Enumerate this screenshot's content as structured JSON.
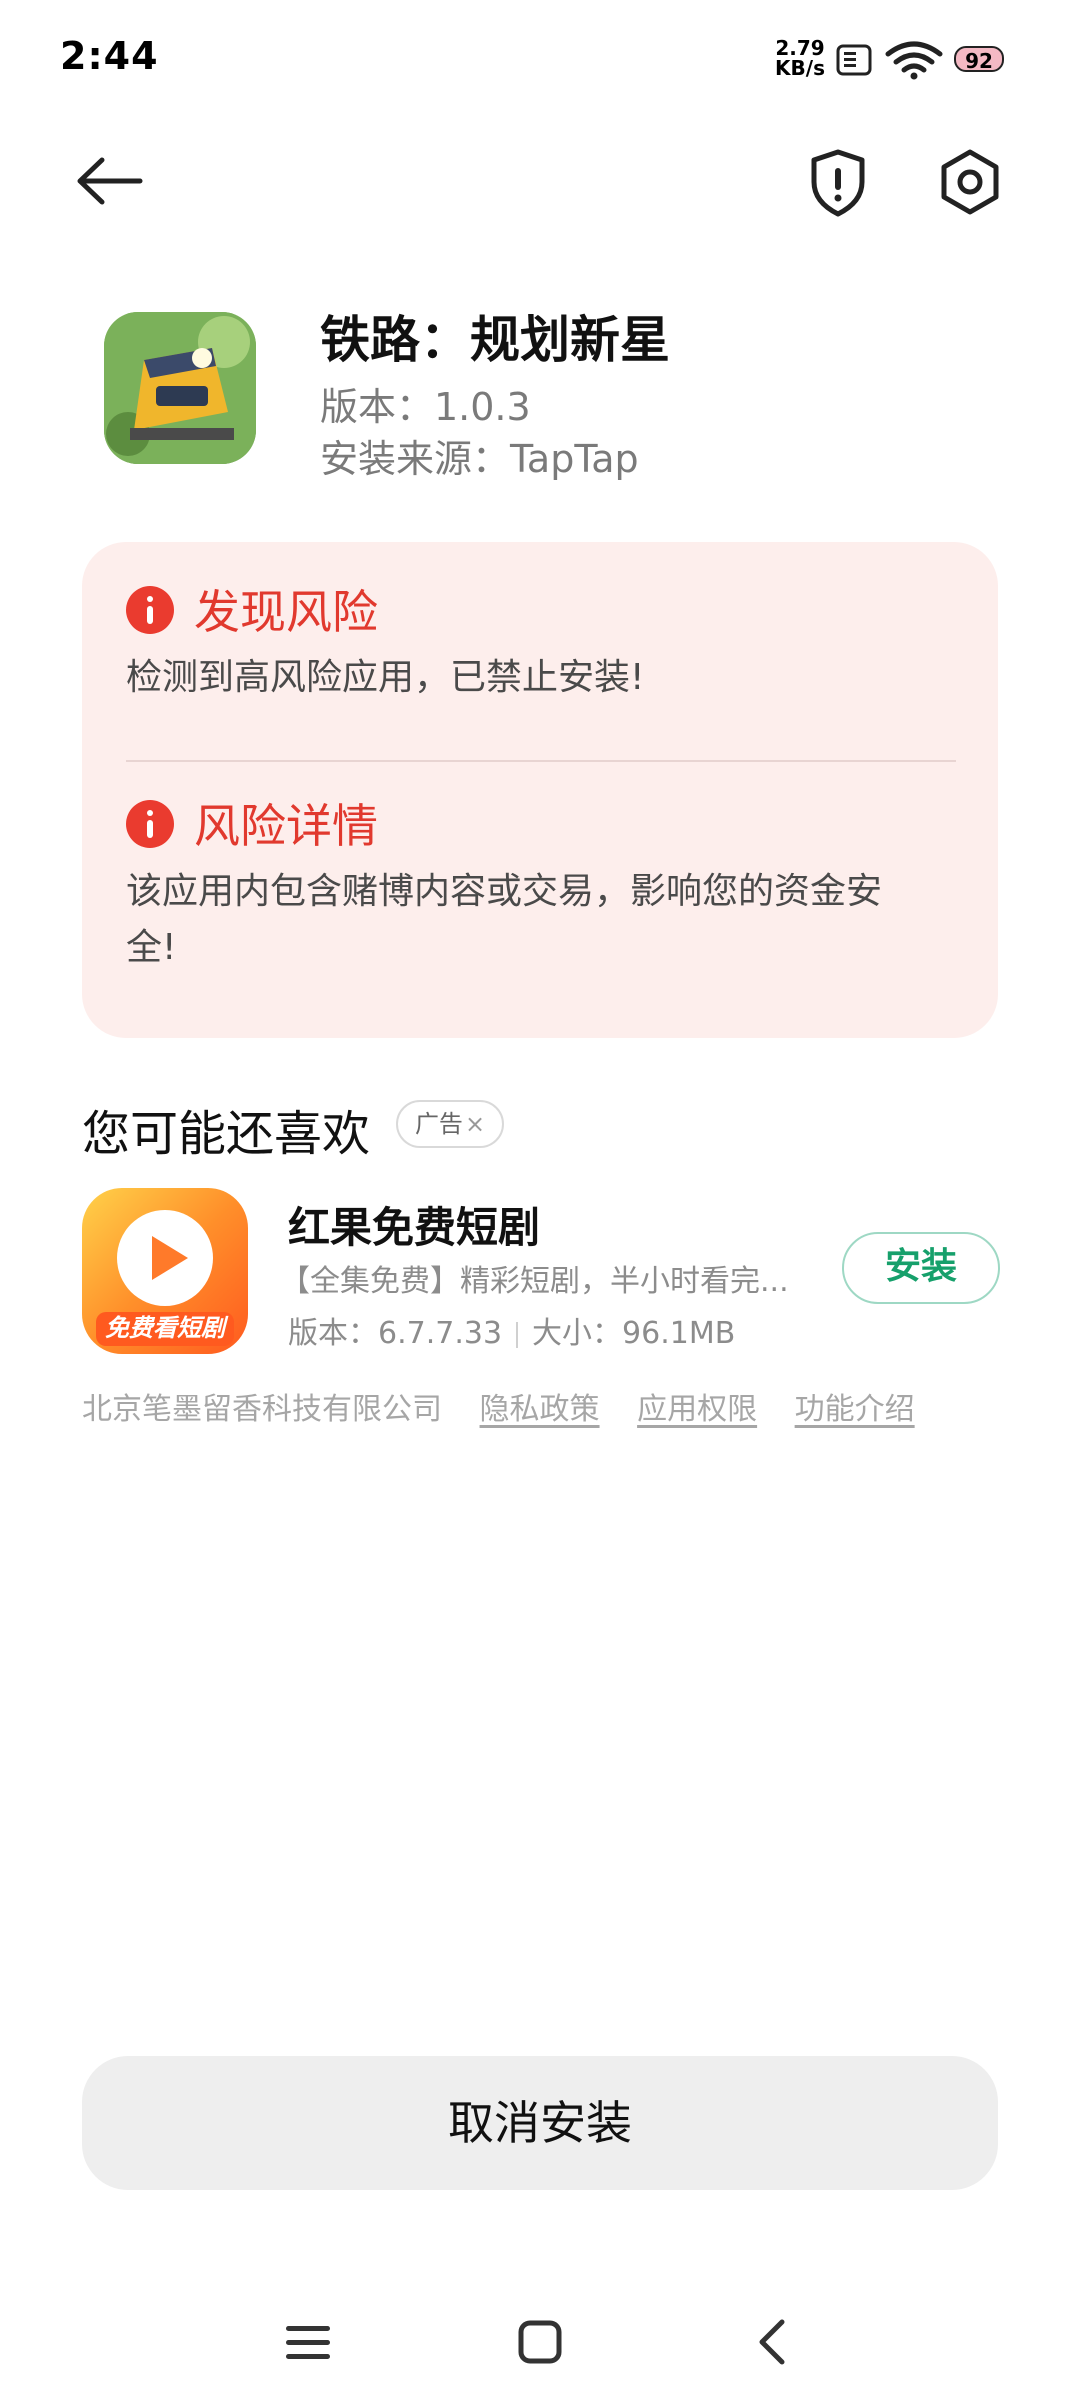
{
  "status_bar": {
    "time": "2:44",
    "net_speed_value": "2.79",
    "net_speed_unit": "KB/s",
    "battery_level": "92"
  },
  "app": {
    "name": "铁路：规划新星",
    "version": "版本：1.0.3",
    "source": "安装来源：TapTap"
  },
  "risk": {
    "title": "发现风险",
    "message": "检测到高风险应用，已禁止安装!",
    "detail_title": "风险详情",
    "detail_line1": "该应用内包含赌博内容或交易，影响您的资金安",
    "detail_line2": "全!",
    "accent_color": "#e1392e"
  },
  "recommendation": {
    "section_title": "您可能还喜欢",
    "ad_label": "广告",
    "ad_close": "×",
    "app": {
      "name": "红果免费短剧",
      "description": "【全集免费】精彩短剧，半小时看完...",
      "version": "版本：6.7.7.33",
      "size": "大小：96.1MB",
      "icon_caption": "免费看短剧",
      "install_label": "安装"
    },
    "company": "北京笔墨留香科技有限公司",
    "links": {
      "privacy": "隐私政策",
      "permissions": "应用权限",
      "features": "功能介绍"
    }
  },
  "footer": {
    "cancel_label": "取消安装"
  },
  "icons": {
    "back": "arrow-left-icon",
    "shield": "shield-alert-icon",
    "settings": "hexagon-gear-icon",
    "menu": "menu-icon",
    "home": "square-home-icon",
    "nav_back": "chevron-left-icon"
  }
}
